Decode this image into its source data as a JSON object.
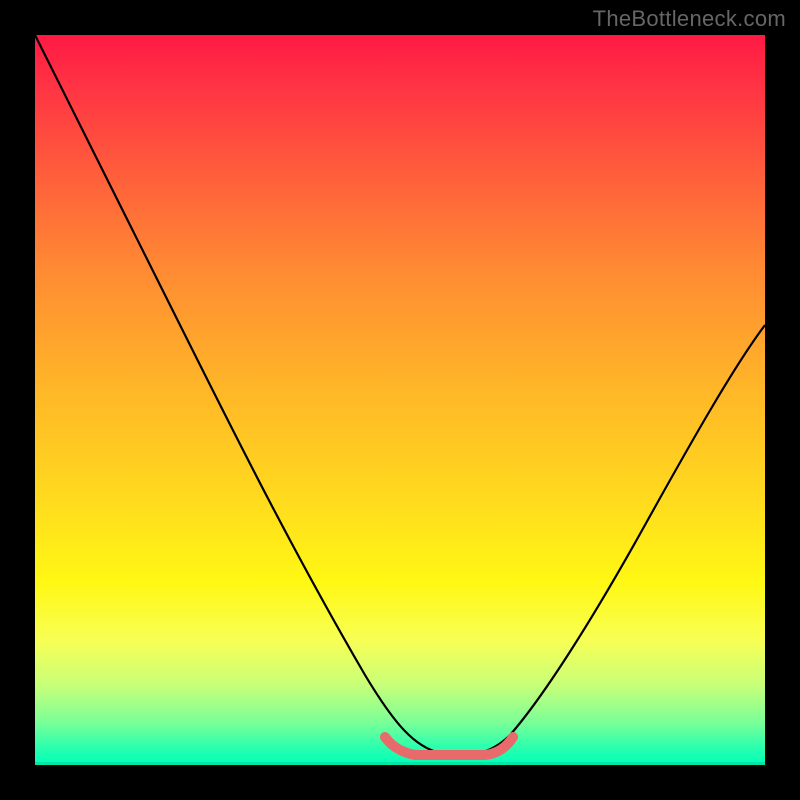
{
  "watermark": "TheBottleneck.com",
  "chart_data": {
    "type": "line",
    "title": "",
    "xlabel": "",
    "ylabel": "",
    "xlim": [
      0,
      100
    ],
    "ylim": [
      0,
      100
    ],
    "gradient": {
      "orientation": "vertical",
      "stops": [
        {
          "pct": 0,
          "color": "#ff1a44"
        },
        {
          "pct": 50,
          "color": "#ffd000"
        },
        {
          "pct": 90,
          "color": "#e8ff60"
        },
        {
          "pct": 100,
          "color": "#00ffb8"
        }
      ]
    },
    "series": [
      {
        "name": "black-curve",
        "color": "#000000",
        "x": [
          0,
          5,
          10,
          15,
          20,
          25,
          30,
          35,
          40,
          45,
          48,
          50,
          55,
          60,
          63,
          66,
          70,
          75,
          80,
          85,
          90,
          95,
          100
        ],
        "values": [
          100,
          90,
          80,
          70,
          59,
          49,
          39,
          30,
          22,
          13,
          8,
          5,
          2,
          1,
          1,
          3,
          8,
          16,
          25,
          34,
          43,
          52,
          60
        ]
      },
      {
        "name": "red-flat-segment",
        "color": "#e86a6a",
        "x": [
          48,
          50,
          55,
          60,
          63
        ],
        "values": [
          3,
          2,
          1.5,
          1.5,
          3
        ]
      }
    ]
  }
}
